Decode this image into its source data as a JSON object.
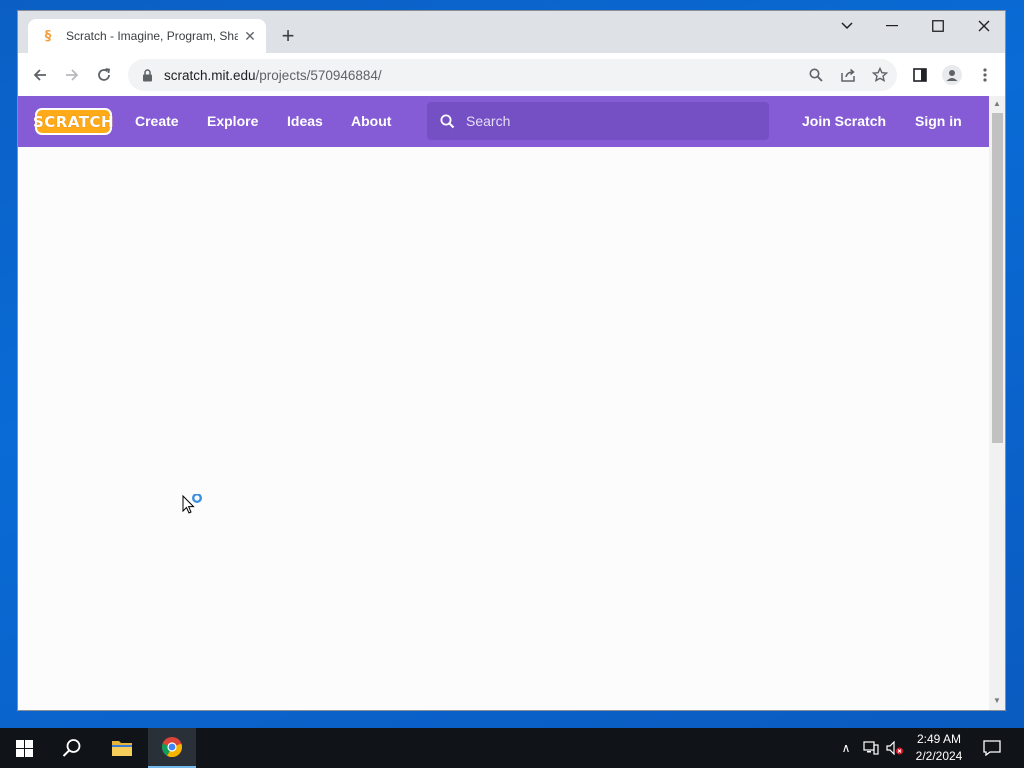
{
  "browser": {
    "tab": {
      "title": "Scratch - Imagine, Program, Share",
      "favicon": "scratch-cat-icon",
      "close_glyph": "✕"
    },
    "new_tab_glyph": "+",
    "window_controls": {
      "dropdown": "⌄",
      "minimize": "—",
      "maximize": "☐",
      "close": "✕"
    },
    "address_bar": {
      "domain": "scratch.mit.edu",
      "path": "/projects/570946884/"
    },
    "toolbar_icons": [
      "back-arrow-icon",
      "forward-arrow-icon",
      "reload-icon",
      "zoom-icon",
      "share-icon",
      "bookmark-star-icon",
      "side-panel-icon",
      "profile-icon",
      "more-menu-icon"
    ]
  },
  "scratch": {
    "logo": "SCRATCH",
    "nav": {
      "create": "Create",
      "explore": "Explore",
      "ideas": "Ideas",
      "about": "About",
      "join": "Join Scratch",
      "signin": "Sign in"
    },
    "search": {
      "placeholder": "Search"
    },
    "colors": {
      "nav_bg": "#855cd6",
      "search_bg": "#7450c4",
      "logo_orange": "#ffab19"
    }
  },
  "taskbar": {
    "clock": {
      "time": "2:49 AM",
      "date": "2/2/2024"
    },
    "items": [
      "windows-start-icon",
      "search-icon",
      "file-explorer-icon",
      "chrome-icon"
    ],
    "tray_chevron": "∧"
  }
}
